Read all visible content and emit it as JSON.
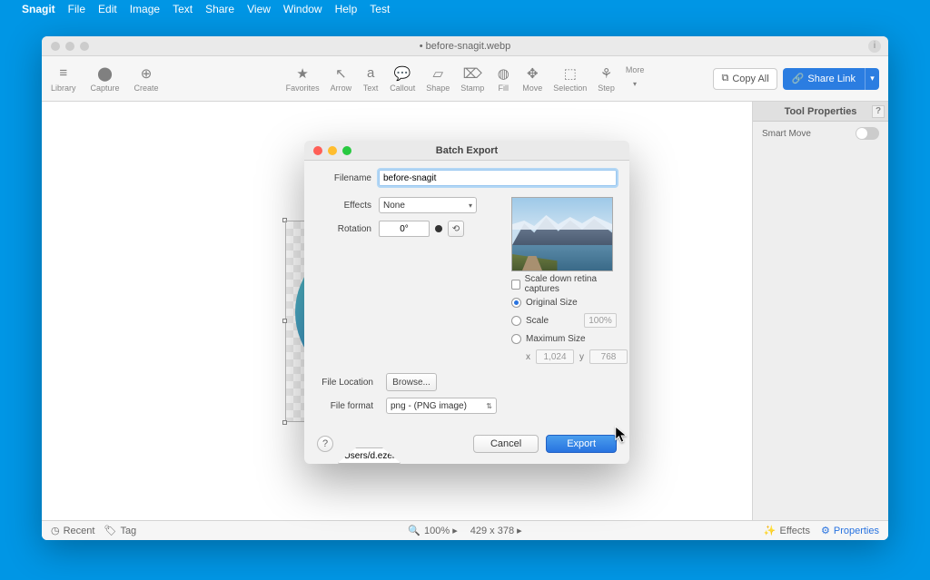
{
  "menubar": {
    "app": "Snagit",
    "items": [
      "File",
      "Edit",
      "Image",
      "Text",
      "Share",
      "View",
      "Window",
      "Help",
      "Test"
    ]
  },
  "window": {
    "title": "• before-snagit.webp",
    "toolbar_left": {
      "menu": "≡",
      "library": "Library",
      "capture_icon": "⬤",
      "capture": "Capture",
      "create_icon": "⊕",
      "create": "Create"
    },
    "tools": [
      {
        "glyph": "★",
        "label": "Favorites"
      },
      {
        "glyph": "↖",
        "label": "Arrow"
      },
      {
        "glyph": "a",
        "label": "Text"
      },
      {
        "glyph": "💬",
        "label": "Callout"
      },
      {
        "glyph": "▱",
        "label": "Shape"
      },
      {
        "glyph": "⌦",
        "label": "Stamp"
      },
      {
        "glyph": "◍",
        "label": "Fill"
      },
      {
        "glyph": "✥",
        "label": "Move"
      },
      {
        "glyph": "⬚",
        "label": "Selection"
      },
      {
        "glyph": "⚘",
        "label": "Step"
      }
    ],
    "more": "More",
    "copy_all": "Copy All",
    "share_link": "Share Link",
    "props_title": "Tool Properties",
    "smart_move": "Smart Move"
  },
  "status": {
    "recent": "Recent",
    "tag": "Tag",
    "zoom": "100% ▸",
    "dims": "429 x 378 ▸",
    "effects": "Effects",
    "properties": "Properties"
  },
  "dialog": {
    "title": "Batch Export",
    "filename_label": "Filename",
    "filename": "before-snagit",
    "effects_label": "Effects",
    "effects_value": "None",
    "rotation_label": "Rotation",
    "rotation_value": "0°",
    "scale_down": "Scale down retina captures",
    "original_size": "Original Size",
    "scale": "Scale",
    "scale_pct": "100%",
    "max_size": "Maximum Size",
    "dim_x_label": "x",
    "dim_x": "1,024",
    "dim_y_label": "y",
    "dim_y": "768",
    "file_location_label": "File Location",
    "file_location": "/Users/d.ezell/Desktop",
    "browse": "Browse...",
    "file_format_label": "File format",
    "file_format": "png - (PNG image)",
    "cancel": "Cancel",
    "export": "Export",
    "help": "?"
  }
}
